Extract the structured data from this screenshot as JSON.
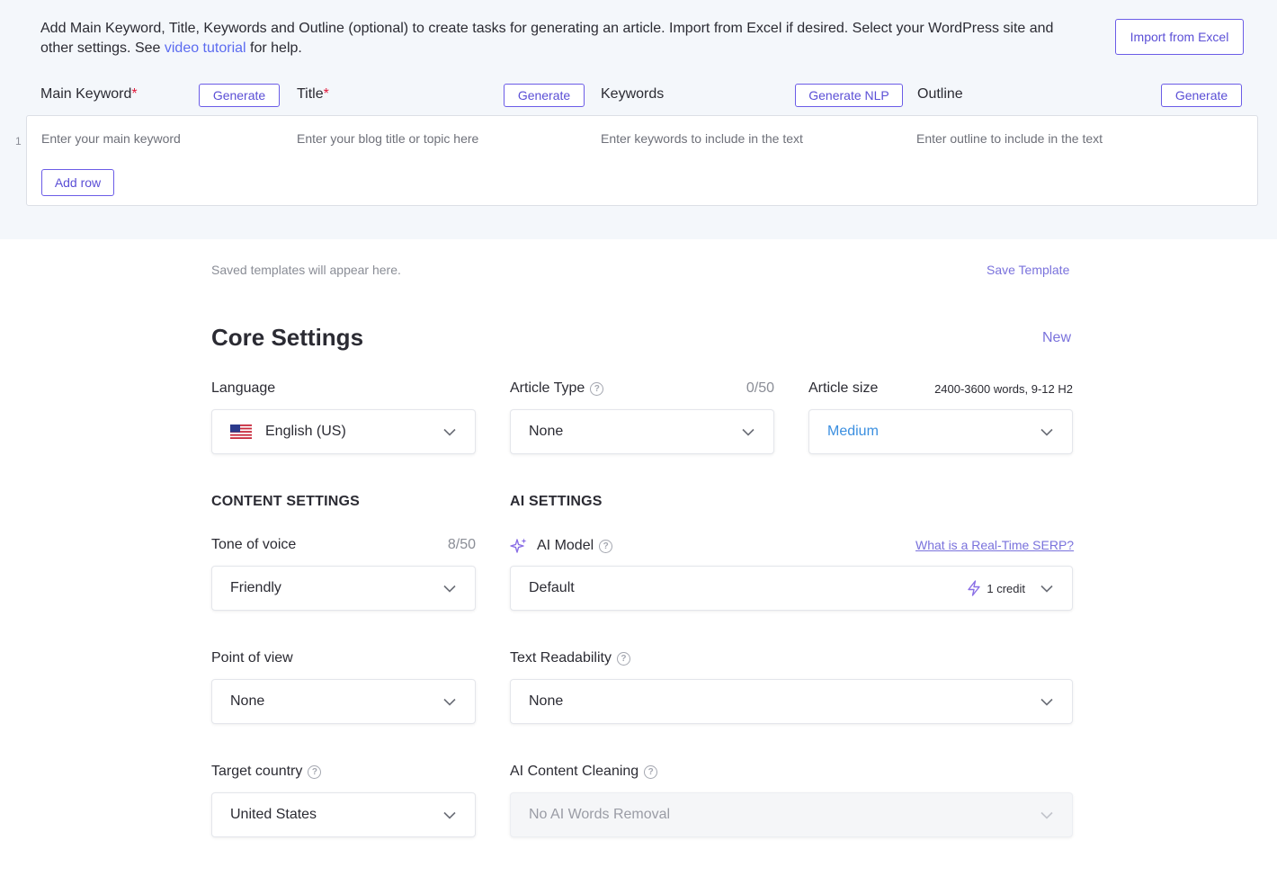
{
  "intro": {
    "text_before_link": "Add Main Keyword, Title, Keywords and Outline (optional) to create tasks for generating an article. Import from Excel if desired. Select your WordPress site and other settings. See ",
    "link_text": "video tutorial",
    "text_after_link": " for help."
  },
  "import_button": "Import from Excel",
  "columns": {
    "main_keyword": {
      "label": "Main Keyword",
      "required": "*",
      "button": "Generate",
      "placeholder": "Enter your main keyword"
    },
    "title": {
      "label": "Title",
      "required": "*",
      "button": "Generate",
      "placeholder": "Enter your blog title or topic here"
    },
    "keywords": {
      "label": "Keywords",
      "button": "Generate NLP",
      "placeholder": "Enter keywords to include in the text"
    },
    "outline": {
      "label": "Outline",
      "button": "Generate",
      "placeholder": "Enter outline to include in the text"
    }
  },
  "row_number": "1",
  "add_row": "Add row",
  "templates": {
    "note": "Saved templates will appear here.",
    "save": "Save Template"
  },
  "core": {
    "title": "Core Settings",
    "new": "New"
  },
  "language": {
    "label": "Language",
    "value": "English (US)"
  },
  "article_type": {
    "label": "Article Type",
    "counter": "0/50",
    "value": "None"
  },
  "article_size": {
    "label": "Article size",
    "info": "2400-3600 words, 9-12 H2",
    "value": "Medium"
  },
  "content_settings": "CONTENT SETTINGS",
  "ai_settings": "AI SETTINGS",
  "tone": {
    "label": "Tone of voice",
    "counter": "8/50",
    "value": "Friendly"
  },
  "ai_model": {
    "label": "AI Model",
    "link": "What is a Real-Time SERP?",
    "value": "Default",
    "credit": "1 credit"
  },
  "point_of_view": {
    "label": "Point of view",
    "value": "None"
  },
  "readability": {
    "label": "Text Readability",
    "value": "None"
  },
  "target_country": {
    "label": "Target country",
    "value": "United States"
  },
  "cleaning": {
    "label": "AI Content Cleaning",
    "value": "No AI Words Removal"
  },
  "help_glyph": "?",
  "colors": {
    "accent": "#6b5ce7",
    "link": "#5b6bf0",
    "required": "#e0193a",
    "medium": "#3b8fe0",
    "panel_bg": "#f4f7fb"
  }
}
